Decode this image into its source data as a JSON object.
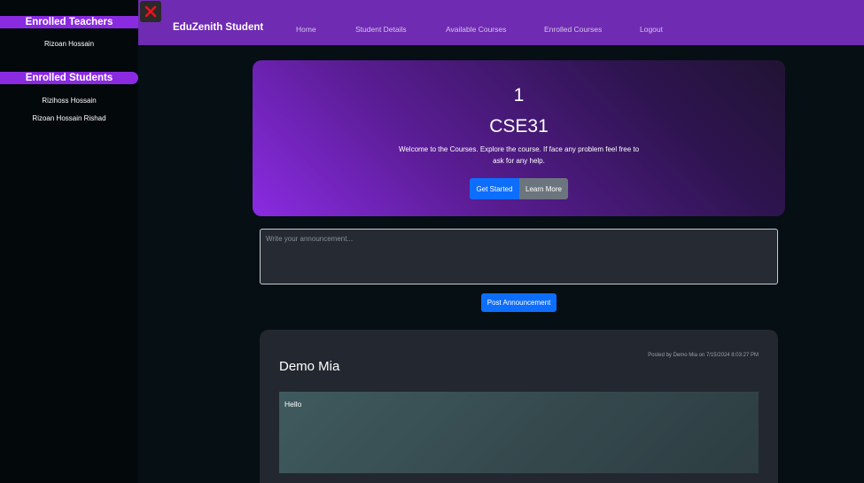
{
  "sidebar": {
    "teachers_heading": "Enrolled Teachers",
    "teachers": [
      "Rizoan Hossain"
    ],
    "students_heading": "Enrolled Students",
    "students": [
      "Rizihoss Hossain",
      "Rizoan Hossain Rishad"
    ],
    "close_icon": "close-x-icon",
    "accent_color": "#8a2be2"
  },
  "navbar": {
    "brand": "EduZenith Student",
    "links": [
      "Home",
      "Student Details",
      "Available Courses",
      "Enrolled Courses",
      "Logout"
    ],
    "bg_color": "#6f2bb1"
  },
  "hero": {
    "number": "1",
    "title": "CSE31",
    "description": "Welcome to the Courses. Explore the course. If face any problem feel free to ask for any help.",
    "get_started_label": "Get Started",
    "learn_more_label": "Learn More"
  },
  "announcement": {
    "placeholder": "Write your announcement...",
    "value": "",
    "post_label": "Post Announcement"
  },
  "posts": [
    {
      "author": "Demo Mia",
      "meta": "Posted by Demo Mia on 7/15/2024 8:03:27 PM",
      "body": "Hello"
    }
  ]
}
